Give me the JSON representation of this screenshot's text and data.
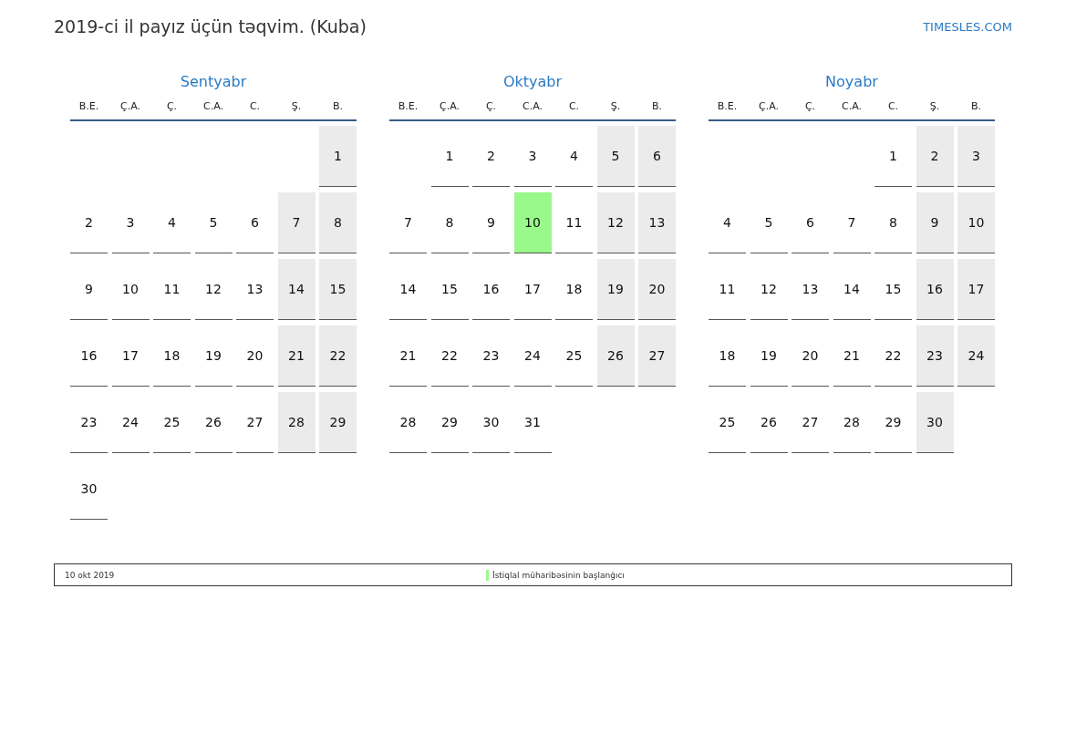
{
  "title": "2019-ci il payız üçün təqvim. (Kuba)",
  "logo": "TIMESLES.COM",
  "months": [
    {
      "name": "Sentyabr",
      "weekdays": [
        "B.E.",
        "Ç.A.",
        "Ç.",
        "C.A.",
        "C.",
        "Ş.",
        "B."
      ],
      "weeks": [
        [
          {
            "kind": "blank"
          },
          {
            "kind": "blank"
          },
          {
            "kind": "blank"
          },
          {
            "kind": "blank"
          },
          {
            "kind": "blank"
          },
          {
            "kind": "blank"
          },
          {
            "kind": "day",
            "day": "1",
            "weekend": true,
            "holiday": false
          }
        ],
        [
          {
            "kind": "day",
            "day": "2",
            "weekend": false,
            "holiday": false
          },
          {
            "kind": "day",
            "day": "3",
            "weekend": false,
            "holiday": false
          },
          {
            "kind": "day",
            "day": "4",
            "weekend": false,
            "holiday": false
          },
          {
            "kind": "day",
            "day": "5",
            "weekend": false,
            "holiday": false
          },
          {
            "kind": "day",
            "day": "6",
            "weekend": false,
            "holiday": false
          },
          {
            "kind": "day",
            "day": "7",
            "weekend": true,
            "holiday": false
          },
          {
            "kind": "day",
            "day": "8",
            "weekend": true,
            "holiday": false
          }
        ],
        [
          {
            "kind": "day",
            "day": "9",
            "weekend": false,
            "holiday": false
          },
          {
            "kind": "day",
            "day": "10",
            "weekend": false,
            "holiday": false
          },
          {
            "kind": "day",
            "day": "11",
            "weekend": false,
            "holiday": false
          },
          {
            "kind": "day",
            "day": "12",
            "weekend": false,
            "holiday": false
          },
          {
            "kind": "day",
            "day": "13",
            "weekend": false,
            "holiday": false
          },
          {
            "kind": "day",
            "day": "14",
            "weekend": true,
            "holiday": false
          },
          {
            "kind": "day",
            "day": "15",
            "weekend": true,
            "holiday": false
          }
        ],
        [
          {
            "kind": "day",
            "day": "16",
            "weekend": false,
            "holiday": false
          },
          {
            "kind": "day",
            "day": "17",
            "weekend": false,
            "holiday": false
          },
          {
            "kind": "day",
            "day": "18",
            "weekend": false,
            "holiday": false
          },
          {
            "kind": "day",
            "day": "19",
            "weekend": false,
            "holiday": false
          },
          {
            "kind": "day",
            "day": "20",
            "weekend": false,
            "holiday": false
          },
          {
            "kind": "day",
            "day": "21",
            "weekend": true,
            "holiday": false
          },
          {
            "kind": "day",
            "day": "22",
            "weekend": true,
            "holiday": false
          }
        ],
        [
          {
            "kind": "day",
            "day": "23",
            "weekend": false,
            "holiday": false
          },
          {
            "kind": "day",
            "day": "24",
            "weekend": false,
            "holiday": false
          },
          {
            "kind": "day",
            "day": "25",
            "weekend": false,
            "holiday": false
          },
          {
            "kind": "day",
            "day": "26",
            "weekend": false,
            "holiday": false
          },
          {
            "kind": "day",
            "day": "27",
            "weekend": false,
            "holiday": false
          },
          {
            "kind": "day",
            "day": "28",
            "weekend": true,
            "holiday": false
          },
          {
            "kind": "day",
            "day": "29",
            "weekend": true,
            "holiday": false
          }
        ],
        [
          {
            "kind": "day",
            "day": "30",
            "weekend": false,
            "holiday": false
          }
        ]
      ]
    },
    {
      "name": "Oktyabr",
      "weekdays": [
        "B.E.",
        "Ç.A.",
        "Ç.",
        "C.A.",
        "C.",
        "Ş.",
        "B."
      ],
      "weeks": [
        [
          {
            "kind": "blank"
          },
          {
            "kind": "day",
            "day": "1",
            "weekend": false,
            "holiday": false
          },
          {
            "kind": "day",
            "day": "2",
            "weekend": false,
            "holiday": false
          },
          {
            "kind": "day",
            "day": "3",
            "weekend": false,
            "holiday": false
          },
          {
            "kind": "day",
            "day": "4",
            "weekend": false,
            "holiday": false
          },
          {
            "kind": "day",
            "day": "5",
            "weekend": true,
            "holiday": false
          },
          {
            "kind": "day",
            "day": "6",
            "weekend": true,
            "holiday": false
          }
        ],
        [
          {
            "kind": "day",
            "day": "7",
            "weekend": false,
            "holiday": false
          },
          {
            "kind": "day",
            "day": "8",
            "weekend": false,
            "holiday": false
          },
          {
            "kind": "day",
            "day": "9",
            "weekend": false,
            "holiday": false
          },
          {
            "kind": "day",
            "day": "10",
            "weekend": false,
            "holiday": true
          },
          {
            "kind": "day",
            "day": "11",
            "weekend": false,
            "holiday": false
          },
          {
            "kind": "day",
            "day": "12",
            "weekend": true,
            "holiday": false
          },
          {
            "kind": "day",
            "day": "13",
            "weekend": true,
            "holiday": false
          }
        ],
        [
          {
            "kind": "day",
            "day": "14",
            "weekend": false,
            "holiday": false
          },
          {
            "kind": "day",
            "day": "15",
            "weekend": false,
            "holiday": false
          },
          {
            "kind": "day",
            "day": "16",
            "weekend": false,
            "holiday": false
          },
          {
            "kind": "day",
            "day": "17",
            "weekend": false,
            "holiday": false
          },
          {
            "kind": "day",
            "day": "18",
            "weekend": false,
            "holiday": false
          },
          {
            "kind": "day",
            "day": "19",
            "weekend": true,
            "holiday": false
          },
          {
            "kind": "day",
            "day": "20",
            "weekend": true,
            "holiday": false
          }
        ],
        [
          {
            "kind": "day",
            "day": "21",
            "weekend": false,
            "holiday": false
          },
          {
            "kind": "day",
            "day": "22",
            "weekend": false,
            "holiday": false
          },
          {
            "kind": "day",
            "day": "23",
            "weekend": false,
            "holiday": false
          },
          {
            "kind": "day",
            "day": "24",
            "weekend": false,
            "holiday": false
          },
          {
            "kind": "day",
            "day": "25",
            "weekend": false,
            "holiday": false
          },
          {
            "kind": "day",
            "day": "26",
            "weekend": true,
            "holiday": false
          },
          {
            "kind": "day",
            "day": "27",
            "weekend": true,
            "holiday": false
          }
        ],
        [
          {
            "kind": "day",
            "day": "28",
            "weekend": false,
            "holiday": false
          },
          {
            "kind": "day",
            "day": "29",
            "weekend": false,
            "holiday": false
          },
          {
            "kind": "day",
            "day": "30",
            "weekend": false,
            "holiday": false
          },
          {
            "kind": "day",
            "day": "31",
            "weekend": false,
            "holiday": false
          }
        ]
      ]
    },
    {
      "name": "Noyabr",
      "weekdays": [
        "B.E.",
        "Ç.A.",
        "Ç.",
        "C.A.",
        "C.",
        "Ş.",
        "B."
      ],
      "weeks": [
        [
          {
            "kind": "blank"
          },
          {
            "kind": "blank"
          },
          {
            "kind": "blank"
          },
          {
            "kind": "blank"
          },
          {
            "kind": "day",
            "day": "1",
            "weekend": false,
            "holiday": false
          },
          {
            "kind": "day",
            "day": "2",
            "weekend": true,
            "holiday": false
          },
          {
            "kind": "day",
            "day": "3",
            "weekend": true,
            "holiday": false
          }
        ],
        [
          {
            "kind": "day",
            "day": "4",
            "weekend": false,
            "holiday": false
          },
          {
            "kind": "day",
            "day": "5",
            "weekend": false,
            "holiday": false
          },
          {
            "kind": "day",
            "day": "6",
            "weekend": false,
            "holiday": false
          },
          {
            "kind": "day",
            "day": "7",
            "weekend": false,
            "holiday": false
          },
          {
            "kind": "day",
            "day": "8",
            "weekend": false,
            "holiday": false
          },
          {
            "kind": "day",
            "day": "9",
            "weekend": true,
            "holiday": false
          },
          {
            "kind": "day",
            "day": "10",
            "weekend": true,
            "holiday": false
          }
        ],
        [
          {
            "kind": "day",
            "day": "11",
            "weekend": false,
            "holiday": false
          },
          {
            "kind": "day",
            "day": "12",
            "weekend": false,
            "holiday": false
          },
          {
            "kind": "day",
            "day": "13",
            "weekend": false,
            "holiday": false
          },
          {
            "kind": "day",
            "day": "14",
            "weekend": false,
            "holiday": false
          },
          {
            "kind": "day",
            "day": "15",
            "weekend": false,
            "holiday": false
          },
          {
            "kind": "day",
            "day": "16",
            "weekend": true,
            "holiday": false
          },
          {
            "kind": "day",
            "day": "17",
            "weekend": true,
            "holiday": false
          }
        ],
        [
          {
            "kind": "day",
            "day": "18",
            "weekend": false,
            "holiday": false
          },
          {
            "kind": "day",
            "day": "19",
            "weekend": false,
            "holiday": false
          },
          {
            "kind": "day",
            "day": "20",
            "weekend": false,
            "holiday": false
          },
          {
            "kind": "day",
            "day": "21",
            "weekend": false,
            "holiday": false
          },
          {
            "kind": "day",
            "day": "22",
            "weekend": false,
            "holiday": false
          },
          {
            "kind": "day",
            "day": "23",
            "weekend": true,
            "holiday": false
          },
          {
            "kind": "day",
            "day": "24",
            "weekend": true,
            "holiday": false
          }
        ],
        [
          {
            "kind": "day",
            "day": "25",
            "weekend": false,
            "holiday": false
          },
          {
            "kind": "day",
            "day": "26",
            "weekend": false,
            "holiday": false
          },
          {
            "kind": "day",
            "day": "27",
            "weekend": false,
            "holiday": false
          },
          {
            "kind": "day",
            "day": "28",
            "weekend": false,
            "holiday": false
          },
          {
            "kind": "day",
            "day": "29",
            "weekend": false,
            "holiday": false
          },
          {
            "kind": "day",
            "day": "30",
            "weekend": true,
            "holiday": false
          }
        ]
      ]
    }
  ],
  "legend": {
    "date": "10 okt 2019",
    "name": "İstiqlal müharibəsinin başlanğıcı",
    "color": "#99f98a"
  }
}
